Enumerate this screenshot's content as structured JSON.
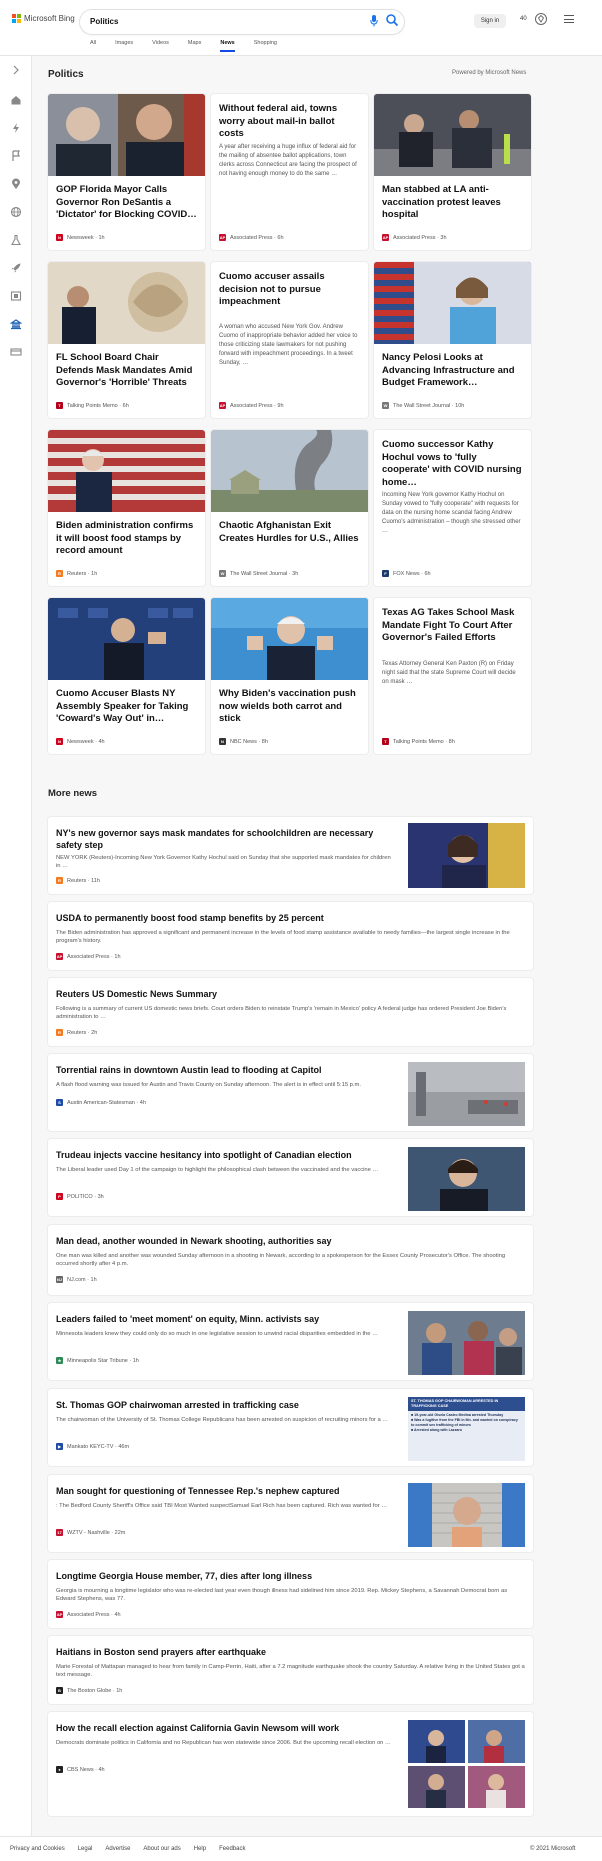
{
  "header": {
    "brand": "Microsoft Bing",
    "query": "Politics",
    "signin_label": "Sign in",
    "points": "40",
    "tabs": [
      "All",
      "Images",
      "Videos",
      "Maps",
      "News",
      "Shopping"
    ],
    "active_tab": "News"
  },
  "section": {
    "title": "Politics",
    "powered_by": "Powered by Microsoft News"
  },
  "cards": [
    {
      "title": "GOP Florida Mayor Calls Governor Ron DeSantis a 'Dictator' for Blocking COVID…",
      "source": "Newsweek",
      "age": "1h",
      "source_color": "#d0021b",
      "source_letter": "N"
    },
    {
      "title": "Without federal aid, towns worry about mail-in ballot costs",
      "snippet": "A year after receiving a huge influx of federal aid for the mailing of absentee ballot applications, town clerks across Connecticut are facing the prospect of not having enough money to do the same …",
      "source": "Associated Press",
      "age": "6h",
      "source_color": "#c8102e",
      "source_letter": "AP"
    },
    {
      "title": "Man stabbed at LA anti-vaccination protest leaves hospital",
      "source": "Associated Press",
      "age": "3h",
      "source_color": "#c8102e",
      "source_letter": "AP"
    },
    {
      "title": "FL School Board Chair Defends Mask Mandates Amid Governor's 'Horrible' Threats",
      "source": "Talking Points Memo",
      "age": "6h",
      "source_color": "#b3001b",
      "source_letter": "T"
    },
    {
      "title": "Cuomo accuser assails decision not to pursue impeachment",
      "snippet": "A woman who accused New York Gov. Andrew Cuomo of inappropriate behavior added her voice to those criticizing state lawmakers for not pushing forward with impeachment proceedings. In a tweet Sunday, …",
      "source": "Associated Press",
      "age": "9h",
      "source_color": "#c8102e",
      "source_letter": "AP"
    },
    {
      "title": "Nancy Pelosi Looks at Advancing Infrastructure and Budget Framework…",
      "source": "The Wall Street Journal",
      "age": "10h",
      "source_color": "#777777",
      "source_letter": "W"
    },
    {
      "title": "Biden administration confirms it will boost food stamps by record amount",
      "source": "Reuters",
      "age": "1h",
      "source_color": "#f47b20",
      "source_letter": "R"
    },
    {
      "title": "Chaotic Afghanistan Exit Creates Hurdles for U.S., Allies",
      "source": "The Wall Street Journal",
      "age": "3h",
      "source_color": "#777777",
      "source_letter": "W"
    },
    {
      "title": "Cuomo successor Kathy Hochul vows to 'fully cooperate' with COVID nursing home…",
      "snippet": "Incoming New York governor Kathy Hochul on Sunday vowed to \"fully cooperate\" with requests for data on the nursing home scandal facing Andrew Cuomo's administration – though she stressed other …",
      "source": "FOX News",
      "age": "6h",
      "source_color": "#1a3a6b",
      "source_letter": "F"
    },
    {
      "title": "Cuomo Accuser Blasts NY Assembly Speaker for Taking 'Coward's Way Out' in…",
      "source": "Newsweek",
      "age": "4h",
      "source_color": "#d0021b",
      "source_letter": "N"
    },
    {
      "title": "Why Biden's vaccination push now wields both carrot and stick",
      "source": "NBC News",
      "age": "8h",
      "source_color": "#333333",
      "source_letter": "N"
    },
    {
      "title": "Texas AG Takes School Mask Mandate Fight To Court After Governor's Failed Efforts",
      "snippet": "Texas Attorney General Ken Paxton (R) on Friday night said that the state Supreme Court will decide on mask …",
      "source": "Talking Points Memo",
      "age": "8h",
      "source_color": "#b3001b",
      "source_letter": "T"
    }
  ],
  "more_news": {
    "title": "More news",
    "items": [
      {
        "title": "NY's new governor says mask mandates for schoolchildren are necessary safety step",
        "snippet": "NEW YORK (Reuters)-Incoming New York Governor Kathy Hochul said on Sunday that she supported mask mandates for children in …",
        "source": "Reuters",
        "age": "11h",
        "source_color": "#f47b20",
        "source_letter": "R"
      },
      {
        "title": "USDA to permanently boost food stamp benefits by 25 percent",
        "snippet": "The Biden administration has approved a significant and permanent increase in the levels of food stamp assistance available to needy families—the largest single increase in the program's history.",
        "source": "Associated Press",
        "age": "1h",
        "source_color": "#c8102e",
        "source_letter": "AP"
      },
      {
        "title": "Reuters US Domestic News Summary",
        "snippet": "Following is a summary of current US domestic news briefs. Court orders Biden to reinstate Trump's 'remain in Mexico' policy A federal judge has ordered President Joe Biden's administration to …",
        "source": "Reuters",
        "age": "2h",
        "source_color": "#f47b20",
        "source_letter": "R"
      },
      {
        "title": "Torrential rains in downtown Austin lead to flooding at Capitol",
        "snippet": "A flash flood warning was issued for Austin and Travis County on Sunday afternoon. The alert is in effect until 5:15 p.m.",
        "source": "Austin American-Statesman",
        "age": "4h",
        "source_color": "#1f4aa8",
        "source_letter": "S"
      },
      {
        "title": "Trudeau injects vaccine hesitancy into spotlight of Canadian election",
        "snippet": "The Liberal leader used Day 1 of the campaign to highlight the philosophical clash between the vaccinated and the vaccine …",
        "source": "POLITICO",
        "age": "3h",
        "source_color": "#d0021b",
        "source_letter": "P"
      },
      {
        "title": "Man dead, another wounded in Newark shooting, authorities say",
        "snippet": "One man was killed and another was wounded Sunday afternoon in a shooting in Newark, according to a spokesperson for the Essex County Prosecutor's Office. The shooting occurred shortly after 4 p.m.",
        "source": "NJ.com",
        "age": "1h",
        "source_color": "#666666",
        "source_letter": "NJ"
      },
      {
        "title": "Leaders failed to 'meet moment' on equity, Minn. activists say",
        "snippet": "Minnesota leaders knew they could only do so much in one legislative session to unwind racial disparities embedded in the …",
        "source": "Minneapolis Star Tribune",
        "age": "1h",
        "source_color": "#2e8b57",
        "source_letter": "★"
      },
      {
        "title": "St. Thomas GOP chairwoman arrested in trafficking case",
        "snippet": "The chairwoman of the University of St. Thomas College Republicans has been arrested on suspicion of recruiting minors for a …",
        "source": "Mankato KEYC-TV",
        "age": "46m",
        "source_color": "#1f4aa8",
        "source_letter": "▶",
        "image_caption": "ST. THOMAS GOP CHAIRWOMAN ARRESTED IN TRAFFICKING CASE",
        "image_bullets": [
          "19-year-old Gisela Castro Medina arrested Thursday",
          "Was a fugitive from the FBI in Mn. and wanted on conspiracy to commit sex trafficking of minors",
          "Arrested along with Lazzaro"
        ]
      },
      {
        "title": "Man sought for questioning of Tennessee Rep.'s nephew captured",
        "snippet": ": The Bedford County Sheriff's Office said TBI Most Wanted suspectSamuel Earl Rich has been captured. Rich was wanted for …",
        "source": "WZTV - Nashville",
        "age": "22m",
        "source_color": "#c8102e",
        "source_letter": "17"
      },
      {
        "title": "Longtime Georgia House member, 77, dies after long illness",
        "snippet": "Georgia is mourning a longtime legislator who was re-elected last year even though illness had sidelined him since 2019. Rep. Mickey Stephens, a Savannah Democrat born as Edward Stephens, was 77.",
        "source": "Associated Press",
        "age": "4h",
        "source_color": "#c8102e",
        "source_letter": "AP"
      },
      {
        "title": "Haitians in Boston send prayers after earthquake",
        "snippet": "Marie Forestal of Mattapan managed to hear from family in Camp-Perrin, Haiti, after a 7.2 magnitude earthquake shook the country Saturday. A relative living in the United States got a text message.",
        "source": "The Boston Globe",
        "age": "1h",
        "source_color": "#222222",
        "source_letter": "B"
      },
      {
        "title": "How the recall election against California Gavin Newsom will work",
        "snippet": "Democrats dominate politics in California and no Republican has won statewide since 2006. But the upcoming recall election on …",
        "source": "CBS News",
        "age": "4h",
        "source_color": "#222222",
        "source_letter": "●"
      }
    ]
  },
  "footer": {
    "links": [
      "Privacy and Cookies",
      "Legal",
      "Advertise",
      "About our ads",
      "Help",
      "Feedback"
    ],
    "copyright": "© 2021 Microsoft"
  }
}
